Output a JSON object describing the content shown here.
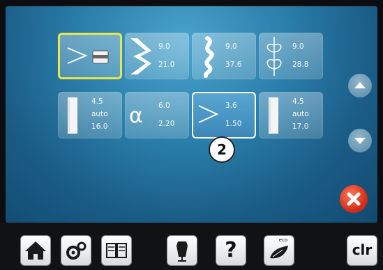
{
  "stitch_tiles": [
    {
      "id": "tile-1",
      "values": [
        "",
        ""
      ]
    },
    {
      "id": "tile-2",
      "values": [
        "9.0",
        "21.0"
      ]
    },
    {
      "id": "tile-3",
      "values": [
        "9.0",
        "37.6"
      ]
    },
    {
      "id": "tile-4",
      "values": [
        "9.0",
        "28.8"
      ]
    },
    {
      "id": "tile-5",
      "values": [
        "4.5",
        "auto",
        "16.0"
      ]
    },
    {
      "id": "tile-6",
      "values": [
        "6.0",
        "2.20"
      ]
    },
    {
      "id": "tile-7",
      "values": [
        "3.6",
        "1.50"
      ]
    },
    {
      "id": "tile-8",
      "values": [
        "4.5",
        "auto",
        "17.0"
      ]
    }
  ],
  "badge": {
    "number": "2"
  },
  "bottom_bar": {
    "clr_label": "clr",
    "help_label": "?",
    "eco_label": "eco"
  },
  "colors": {
    "selected_border": "#ffffff",
    "highlight_border": "#e8e64a",
    "close": "#d8301a"
  }
}
